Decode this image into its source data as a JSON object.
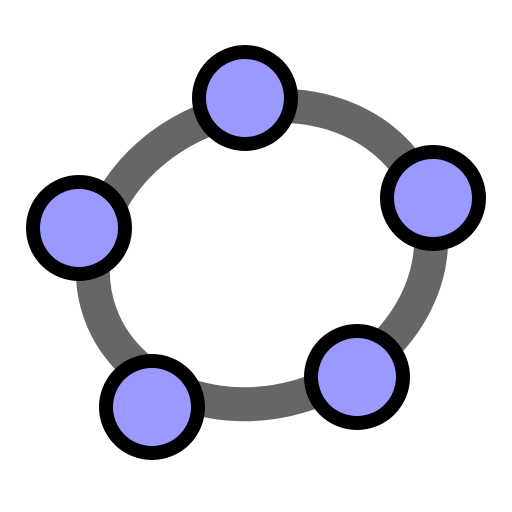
{
  "logo": {
    "name": "geogebra-logo-icon",
    "colors": {
      "background": "#ffffff",
      "curve": "#666666",
      "point_fill": "#9999ff",
      "point_outline": "#000000"
    },
    "point_count": 5
  }
}
